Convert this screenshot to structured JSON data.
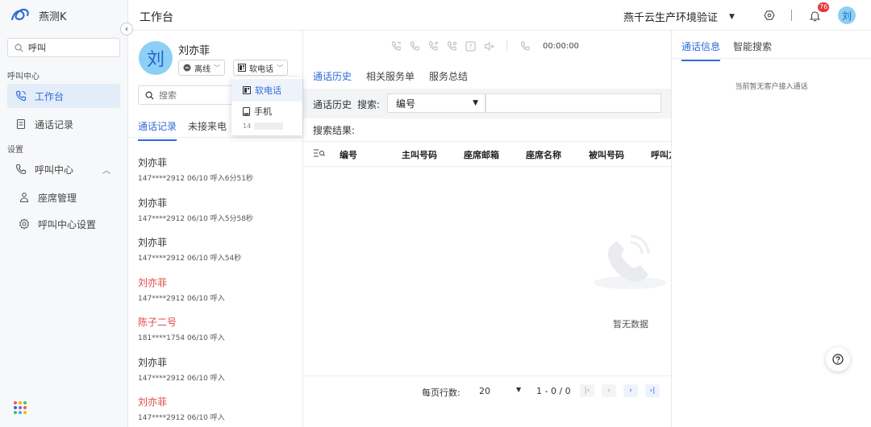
{
  "app": {
    "name": "燕测K"
  },
  "sidebar": {
    "search_value": "呼叫",
    "section_call_center": "呼叫中心",
    "item_workbench": "工作台",
    "item_call_records": "通话记录",
    "section_settings": "设置",
    "item_call_center": "呼叫中心",
    "item_seat_mgmt": "座席管理",
    "item_call_center_settings": "呼叫中心设置"
  },
  "header": {
    "title": "工作台",
    "environment": "燕千云生产环境验证",
    "notification_count": "76",
    "user_initial": "刘"
  },
  "agent": {
    "initial": "刘",
    "name": "刘亦菲",
    "status": "离线",
    "device": "软电话",
    "search_placeholder": "搜索",
    "tab_history": "通话记录",
    "tab_missed": "未接来电"
  },
  "device_menu": {
    "softphone": "软电话",
    "mobile": "手机",
    "mobile_prefix": "14"
  },
  "calls": [
    {
      "name": "刘亦菲",
      "meta": "147****2912  06/10  呼入6分51秒",
      "missed": false
    },
    {
      "name": "刘亦菲",
      "meta": "147****2912  06/10  呼入5分58秒",
      "missed": false
    },
    {
      "name": "刘亦菲",
      "meta": "147****2912  06/10  呼入54秒",
      "missed": false
    },
    {
      "name": "刘亦菲",
      "meta": "147****2912  06/10  呼入",
      "missed": true
    },
    {
      "name": "陈子二号",
      "meta": "181****1754  06/10  呼入",
      "missed": true
    },
    {
      "name": "刘亦菲",
      "meta": "147****2912  06/10  呼入",
      "missed": false
    },
    {
      "name": "刘亦菲",
      "meta": "147****2912  06/10  呼入",
      "missed": true
    }
  ],
  "center": {
    "timer": "00:00:00",
    "tab_history": "通话历史",
    "tab_service_orders": "相关服务单",
    "tab_summary": "服务总结",
    "strip_label": "通话历史",
    "search_label": "搜索:",
    "search_field": "编号",
    "results_label": "搜索结果:",
    "columns": [
      "编号",
      "主叫号码",
      "座席邮箱",
      "座席名称",
      "被叫号码",
      "呼叫方向"
    ],
    "empty_text": "暂无数据",
    "pager_label": "每页行数:",
    "pager_rows": "20",
    "pager_range": "1 - 0 / 0"
  },
  "right": {
    "tab_call_info": "通话信息",
    "tab_smart_search": "智能搜索",
    "empty_text": "当前暂无客户接入通话"
  },
  "colors": {
    "accent": "#2f6bd6",
    "missed": "#e04848",
    "avatar_bg": "#8dcff5",
    "badge": "#e5393b"
  }
}
